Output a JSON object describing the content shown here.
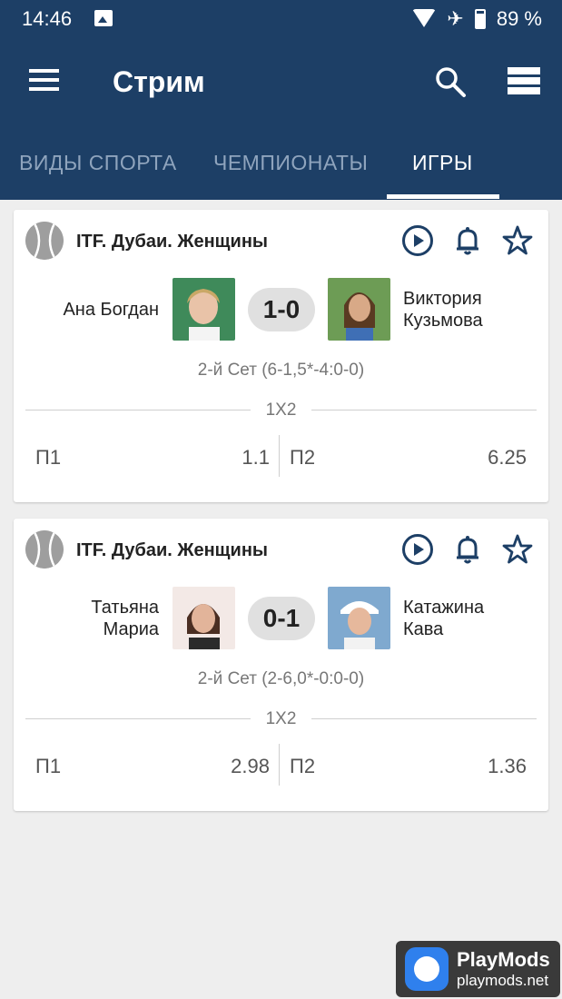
{
  "status_bar": {
    "time": "14:46",
    "battery": "89 %"
  },
  "app_bar": {
    "title": "Стрим"
  },
  "tabs": [
    {
      "label": "ВИДЫ СПОРТА",
      "active": false
    },
    {
      "label": "ЧЕМПИОНАТЫ",
      "active": false
    },
    {
      "label": "ИГРЫ",
      "active": true
    }
  ],
  "colors": {
    "primary": "#1d3f66",
    "background": "#eeeeee",
    "card": "#ffffff"
  },
  "matches": [
    {
      "league": "ITF. Дубаи. Женщины",
      "player1": [
        "Ана Богдан"
      ],
      "player2": [
        "Виктория",
        "Кузьмова"
      ],
      "score": "1-0",
      "set_info": "2-й Сет (6-1,5*-4:0-0)",
      "market": "1X2",
      "odds": [
        {
          "label": "П1",
          "value": "1.1"
        },
        {
          "label": "П2",
          "value": "6.25"
        }
      ]
    },
    {
      "league": "ITF. Дубаи. Женщины",
      "player1": [
        "Татьяна",
        "Мариа"
      ],
      "player2": [
        "Катажина",
        "Кава"
      ],
      "score": "0-1",
      "set_info": "2-й Сет (2-6,0*-0:0-0)",
      "market": "1X2",
      "odds": [
        {
          "label": "П1",
          "value": "2.98"
        },
        {
          "label": "П2",
          "value": "1.36"
        }
      ]
    }
  ],
  "watermark": {
    "brand": "PlayMods",
    "site": "playmods.net"
  }
}
